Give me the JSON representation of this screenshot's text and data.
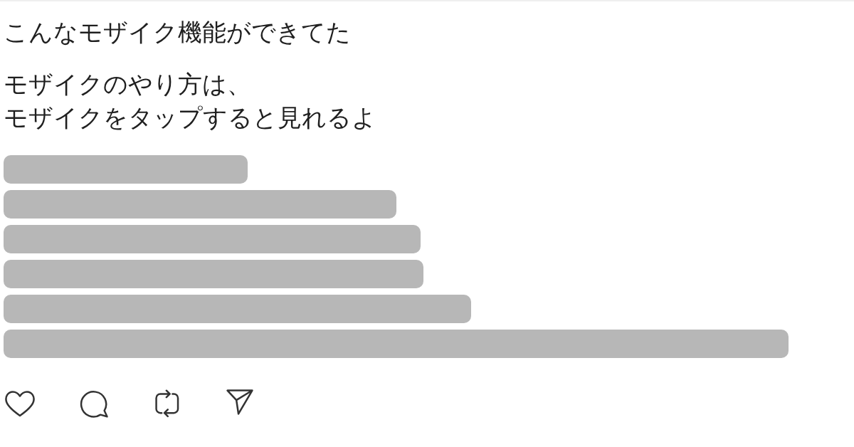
{
  "post": {
    "paragraphs": [
      [
        "こんなモザイク機能ができてた"
      ],
      [
        "モザイクのやり方は、",
        "モザイクをタップすると見れるよ"
      ]
    ]
  }
}
